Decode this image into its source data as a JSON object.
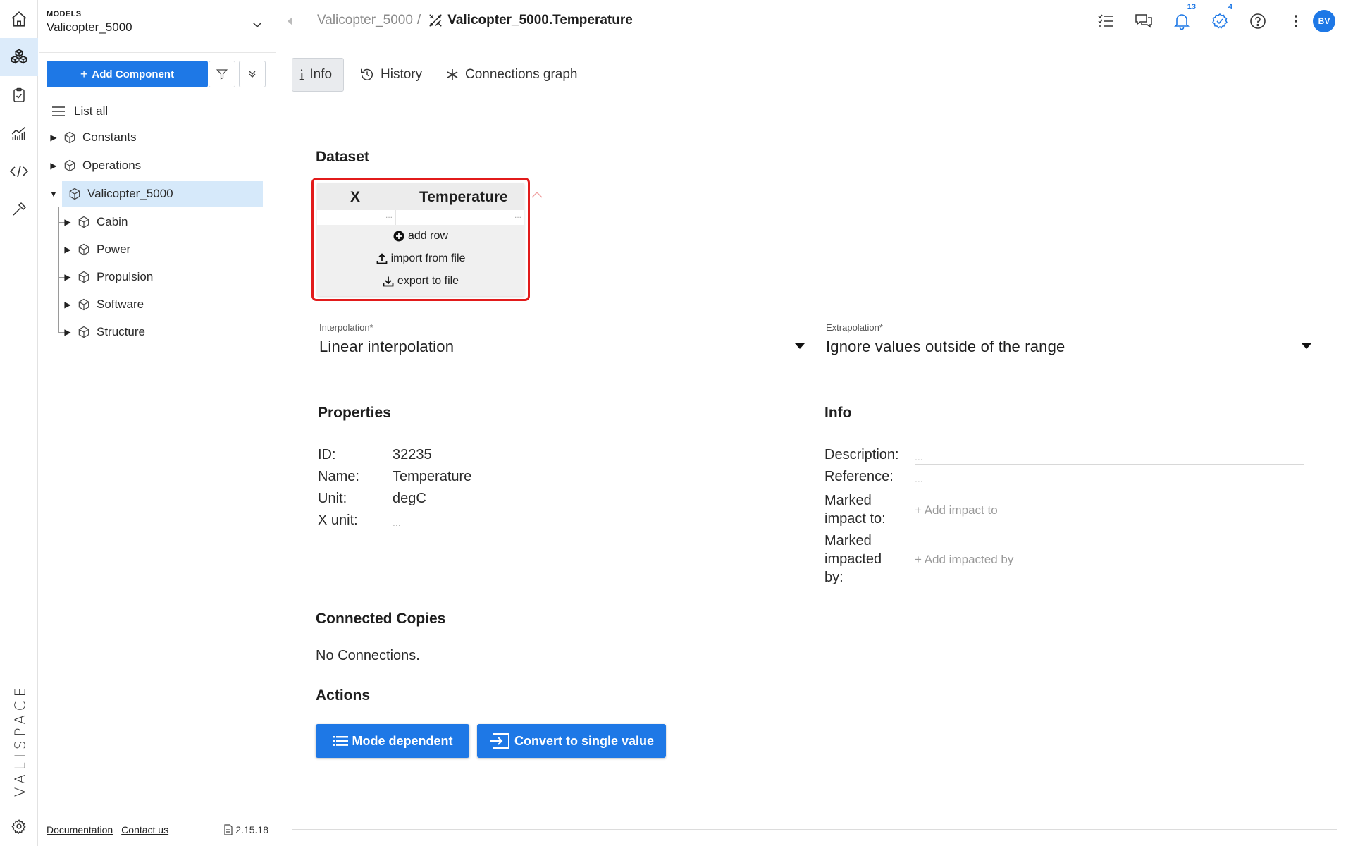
{
  "rail": {
    "items": [
      {
        "icon": "home-icon"
      },
      {
        "icon": "components-icon",
        "active": true
      },
      {
        "icon": "requirements-icon"
      },
      {
        "icon": "analysis-icon"
      },
      {
        "icon": "code-icon"
      },
      {
        "icon": "tools-icon"
      }
    ],
    "logo_text": "VALISPACE",
    "settings_icon": "gear-icon"
  },
  "sidebar": {
    "models_label": "MODELS",
    "model_name": "Valicopter_5000",
    "add_component_label": "Add Component",
    "tree": [
      {
        "label": "List all",
        "kind": "list"
      },
      {
        "label": "Constants",
        "kind": "node",
        "depth": 0,
        "expanded": false
      },
      {
        "label": "Operations",
        "kind": "node",
        "depth": 0,
        "expanded": false
      },
      {
        "label": "Valicopter_5000",
        "kind": "node",
        "depth": 0,
        "expanded": true,
        "selected": true
      },
      {
        "label": "Cabin",
        "kind": "node",
        "depth": 1,
        "expanded": false
      },
      {
        "label": "Power",
        "kind": "node",
        "depth": 1,
        "expanded": false
      },
      {
        "label": "Propulsion",
        "kind": "node",
        "depth": 1,
        "expanded": false
      },
      {
        "label": "Software",
        "kind": "node",
        "depth": 1,
        "expanded": false
      },
      {
        "label": "Structure",
        "kind": "node",
        "depth": 1,
        "expanded": false
      }
    ],
    "footer": {
      "documentation": "Documentation",
      "contact": "Contact us",
      "version": "2.15.18"
    }
  },
  "header": {
    "breadcrumb_parent": "Valicopter_5000",
    "breadcrumb_sep": "/",
    "breadcrumb_current": "Valicopter_5000.Temperature",
    "notifications_count": "13",
    "tasks_count": "4",
    "avatar_initials": "BV"
  },
  "tabs": [
    {
      "label": "Info",
      "active": true
    },
    {
      "label": "History"
    },
    {
      "label": "Connections graph"
    }
  ],
  "dataset": {
    "title": "Dataset",
    "col_x": "X",
    "col_value": "Temperature",
    "empty_cell": "...",
    "add_row": "add row",
    "import": "import from file",
    "export": "export to file"
  },
  "interpolation": {
    "label": "Interpolation*",
    "value": "Linear interpolation"
  },
  "extrapolation": {
    "label": "Extrapolation*",
    "value": "Ignore values outside of the range"
  },
  "properties": {
    "title": "Properties",
    "id_label": "ID:",
    "id_value": "32235",
    "name_label": "Name:",
    "name_value": "Temperature",
    "unit_label": "Unit:",
    "unit_value": "degC",
    "xunit_label": "X unit:",
    "xunit_value": "..."
  },
  "info": {
    "title": "Info",
    "description_label": "Description:",
    "description_value": "...",
    "reference_label": "Reference:",
    "reference_value": "...",
    "impact_to_label_1": "Marked",
    "impact_to_label_2": "impact to:",
    "impact_to_link": "+ Add impact to",
    "impacted_by_label_1": "Marked",
    "impacted_by_label_2": "impacted",
    "impacted_by_label_3": "by:",
    "impacted_by_link": "+ Add impacted by"
  },
  "connected_copies": {
    "title": "Connected Copies",
    "text": "No Connections."
  },
  "actions": {
    "title": "Actions",
    "mode_dependent": "Mode dependent",
    "convert": "Convert to single value"
  },
  "colors": {
    "primary": "#1e78e6",
    "highlight_border": "#e21b1b",
    "selected_row": "#d6e9fa"
  }
}
